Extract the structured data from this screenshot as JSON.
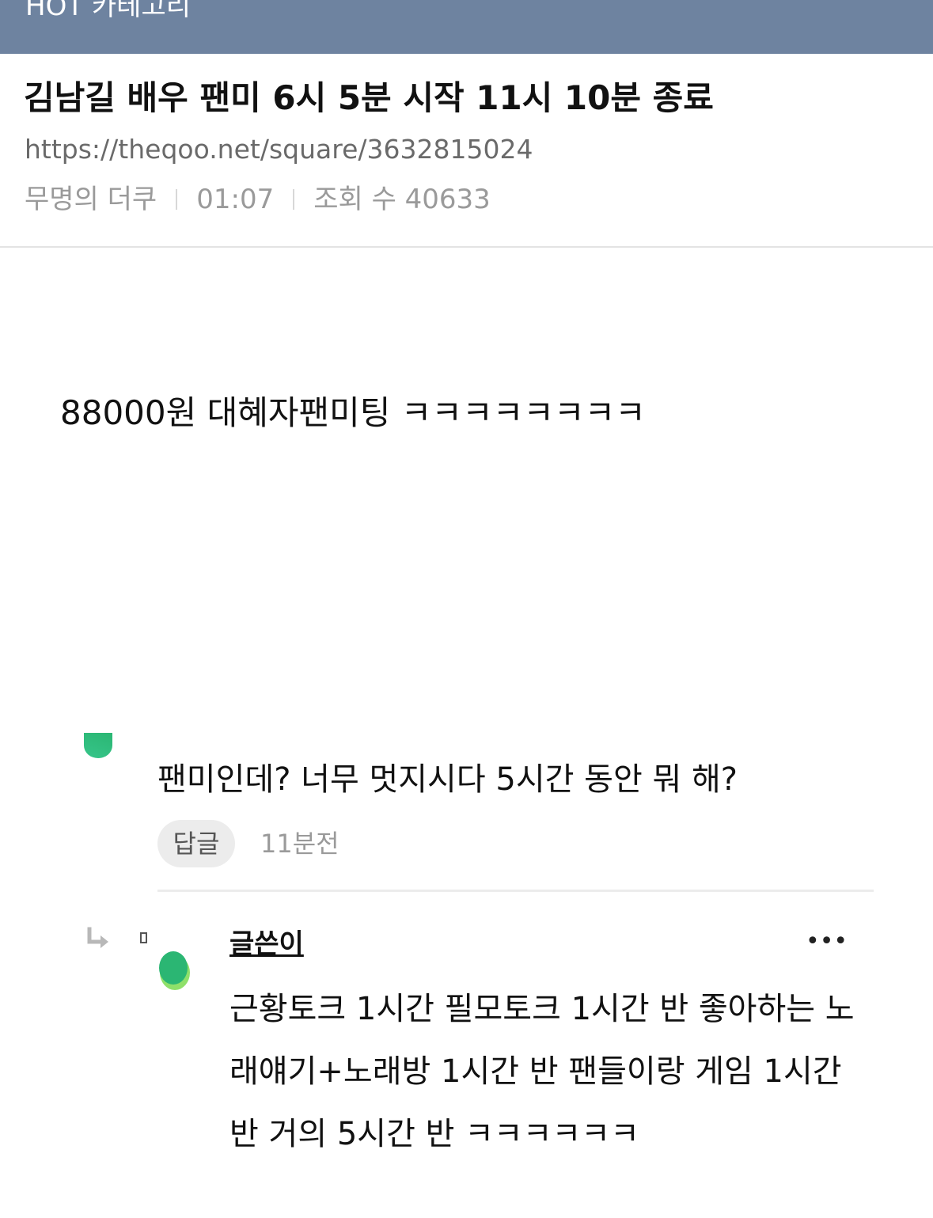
{
  "topbar": {
    "title": "HOT 카테고리",
    "color": "#6e83a0"
  },
  "post": {
    "title": "김남길 배우 팬미 6시 5분 시작 11시 10분 종료",
    "url": "https://theqoo.net/square/3632815024",
    "author": "무명의 더쿠",
    "time": "01:07",
    "views_label": "조회 수 40633",
    "body": "88000원 대혜자팬미팅 ㅋㅋㅋㅋㅋㅋㅋㅋ"
  },
  "comments": [
    {
      "avatar_icon": "avatar-icon",
      "text": "팬미인데? 너무 멋지시다 5시간 동안 뭐 해?",
      "reply_label": "답글",
      "time": "11분전"
    },
    {
      "reply_icon": "reply-arrow-icon",
      "avatar_icon": "avatar-icon",
      "author": "글쓴이",
      "more_icon": "more-icon",
      "more_label": "•••",
      "text": "근황토크 1시간 필모토크 1시간 반 좋아하는 노래얘기+노래방 1시간 반 팬들이랑 게임 1시간 반 거의 5시간 반 ㅋㅋㅋㅋㅋㅋ"
    }
  ],
  "colors": {
    "avatar_green": "#2bb673",
    "avatar_light": "#8fe06a"
  }
}
